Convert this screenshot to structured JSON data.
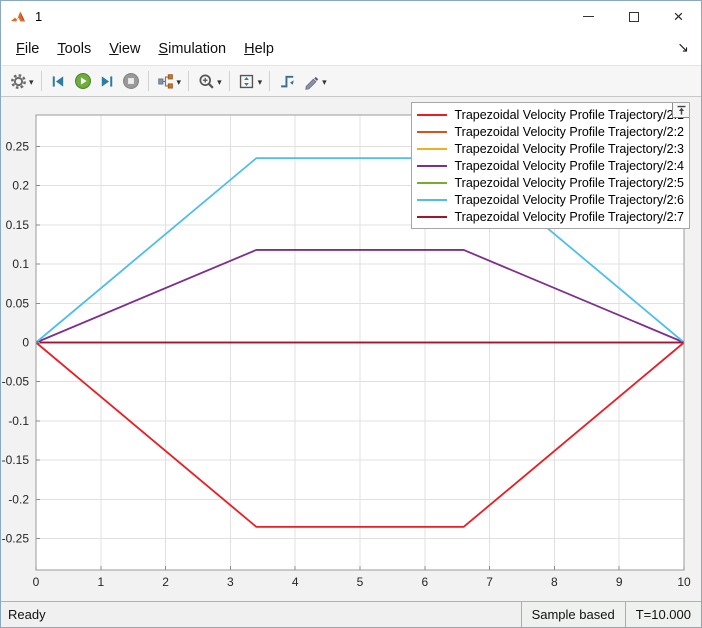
{
  "window": {
    "title": "1",
    "controls": {
      "minimize": "minimize",
      "maximize": "maximize",
      "close": "close"
    }
  },
  "icons": {
    "caret": "▾",
    "menu_arrow": "↘",
    "close": "×"
  },
  "menu": {
    "items": [
      "File",
      "Tools",
      "View",
      "Simulation",
      "Help"
    ]
  },
  "toolbar": {
    "buttons": [
      {
        "name": "settings-gear",
        "dropdown": true
      },
      {
        "name": "step-back",
        "dropdown": false
      },
      {
        "name": "run",
        "dropdown": false
      },
      {
        "name": "step-forward",
        "dropdown": false
      },
      {
        "name": "stop",
        "dropdown": false
      },
      {
        "name": "signal-selector",
        "dropdown": true
      },
      {
        "name": "zoom",
        "dropdown": true
      },
      {
        "name": "fit-to-view",
        "dropdown": true
      },
      {
        "name": "trigger",
        "dropdown": false
      },
      {
        "name": "measurements",
        "dropdown": true
      }
    ]
  },
  "chart_data": {
    "type": "line",
    "title": "",
    "xlabel": "",
    "ylabel": "",
    "xlim": [
      0,
      10
    ],
    "ylim": [
      -0.29,
      0.29
    ],
    "xticks": [
      0,
      1,
      2,
      3,
      4,
      5,
      6,
      7,
      8,
      9,
      10
    ],
    "xtick_labels": [
      "0",
      "1",
      "2",
      "3",
      "4",
      "5",
      "6",
      "7",
      "8",
      "9",
      "10"
    ],
    "yticks": [
      -0.25,
      -0.2,
      -0.15,
      -0.1,
      -0.05,
      0,
      0.05,
      0.1,
      0.15,
      0.2,
      0.25
    ],
    "ytick_labels": [
      "-0.25",
      "-0.2",
      "-0.15",
      "-0.1",
      "-0.05",
      "0",
      "0.05",
      "0.1",
      "0.15",
      "0.2",
      "0.25"
    ],
    "grid": true,
    "legend_position": "top-right",
    "series": [
      {
        "name": "Trapezoidal Velocity Profile Trajectory/2:1",
        "color": "#ed1c24",
        "x": [
          0,
          3.4,
          6.6,
          10
        ],
        "y": [
          0,
          -0.235,
          -0.235,
          0
        ]
      },
      {
        "name": "Trapezoidal Velocity Profile Trajectory/2:2",
        "color": "#d95319",
        "x": [
          0,
          10
        ],
        "y": [
          0,
          0
        ]
      },
      {
        "name": "Trapezoidal Velocity Profile Trajectory/2:3",
        "color": "#edb120",
        "x": [
          0,
          10
        ],
        "y": [
          0,
          0
        ]
      },
      {
        "name": "Trapezoidal Velocity Profile Trajectory/2:4",
        "color": "#7e2f8e",
        "x": [
          0,
          3.4,
          6.6,
          10
        ],
        "y": [
          0,
          0.118,
          0.118,
          0
        ]
      },
      {
        "name": "Trapezoidal Velocity Profile Trajectory/2:5",
        "color": "#77ac30",
        "x": [
          0,
          10
        ],
        "y": [
          0,
          0
        ]
      },
      {
        "name": "Trapezoidal Velocity Profile Trajectory/2:6",
        "color": "#4dbeee",
        "x": [
          0,
          3.4,
          6.6,
          10
        ],
        "y": [
          0,
          0.235,
          0.235,
          0
        ]
      },
      {
        "name": "Trapezoidal Velocity Profile Trajectory/2:7",
        "color": "#a2142f",
        "x": [
          0,
          10
        ],
        "y": [
          0,
          0
        ]
      }
    ]
  },
  "statusbar": {
    "ready": "Ready",
    "sample_mode": "Sample based",
    "time": "T=10.000"
  }
}
